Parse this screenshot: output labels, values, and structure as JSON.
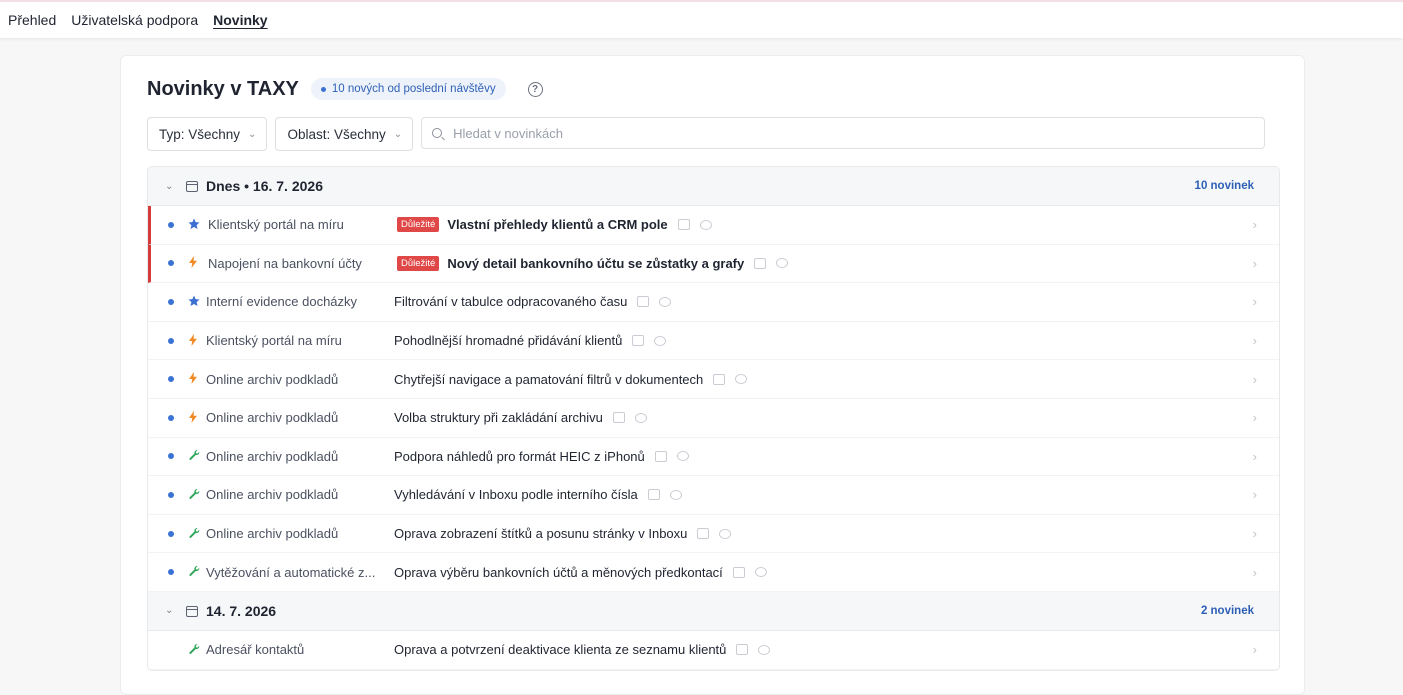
{
  "nav": {
    "items": [
      {
        "label": "Přehled",
        "active": false
      },
      {
        "label": "Uživatelská podpora",
        "active": false
      },
      {
        "label": "Novinky",
        "active": true
      }
    ]
  },
  "header": {
    "title": "Novinky v TAXY",
    "badge": "10 nových od poslední návštěvy",
    "help_icon": "question-circle-icon"
  },
  "filters": {
    "type_label": "Typ: Všechny",
    "area_label": "Oblast: Všechny",
    "search_placeholder": "Hledat v novinkách",
    "search_value": ""
  },
  "groups": [
    {
      "title": "Dnes • 16. 7. 2026",
      "count": "10 novinek",
      "items": [
        {
          "icon": "star",
          "area": "Klientský portál na míru",
          "tag": "Důležité",
          "text": "Vlastní přehledy klientů a CRM pole",
          "important": true,
          "unread": true
        },
        {
          "icon": "bolt",
          "area": "Napojení na bankovní účty",
          "tag": "Důležité",
          "text": "Nový detail bankovního účtu se zůstatky a grafy",
          "important": true,
          "unread": true
        },
        {
          "icon": "star",
          "area": "Interní evidence docházky",
          "tag": "",
          "text": "Filtrování v tabulce odpracovaného času",
          "important": false,
          "unread": true
        },
        {
          "icon": "bolt",
          "area": "Klientský portál na míru",
          "tag": "",
          "text": "Pohodlnější hromadné přidávání klientů",
          "important": false,
          "unread": true
        },
        {
          "icon": "bolt",
          "area": "Online archiv podkladů",
          "tag": "",
          "text": "Chytřejší navigace a pamatování filtrů v dokumentech",
          "important": false,
          "unread": true
        },
        {
          "icon": "bolt",
          "area": "Online archiv podkladů",
          "tag": "",
          "text": "Volba struktury při zakládání archivu",
          "important": false,
          "unread": true
        },
        {
          "icon": "wrench",
          "area": "Online archiv podkladů",
          "tag": "",
          "text": "Podpora náhledů pro formát HEIC z iPhonů",
          "important": false,
          "unread": true
        },
        {
          "icon": "wrench",
          "area": "Online archiv podkladů",
          "tag": "",
          "text": "Vyhledávání v Inboxu podle interního čísla",
          "important": false,
          "unread": true
        },
        {
          "icon": "wrench",
          "area": "Online archiv podkladů",
          "tag": "",
          "text": "Oprava zobrazení štítků a posunu stránky v Inboxu",
          "important": false,
          "unread": true
        },
        {
          "icon": "wrench",
          "area": "Vytěžování a automatické z...",
          "tag": "",
          "text": "Oprava výběru bankovních účtů a měnových předkontací",
          "important": false,
          "unread": true
        }
      ]
    },
    {
      "title": "14. 7. 2026",
      "count": "2 novinek",
      "items": [
        {
          "icon": "wrench",
          "area": "Adresář kontaktů",
          "tag": "",
          "text": "Oprava a potvrzení deaktivace klienta ze seznamu klientů",
          "important": false,
          "unread": false
        }
      ]
    }
  ],
  "colors": {
    "accent": "#2d5fb6",
    "important": "#e04848",
    "star": "#3b6fd1",
    "bolt": "#f08a24",
    "wrench": "#2fa65a"
  }
}
